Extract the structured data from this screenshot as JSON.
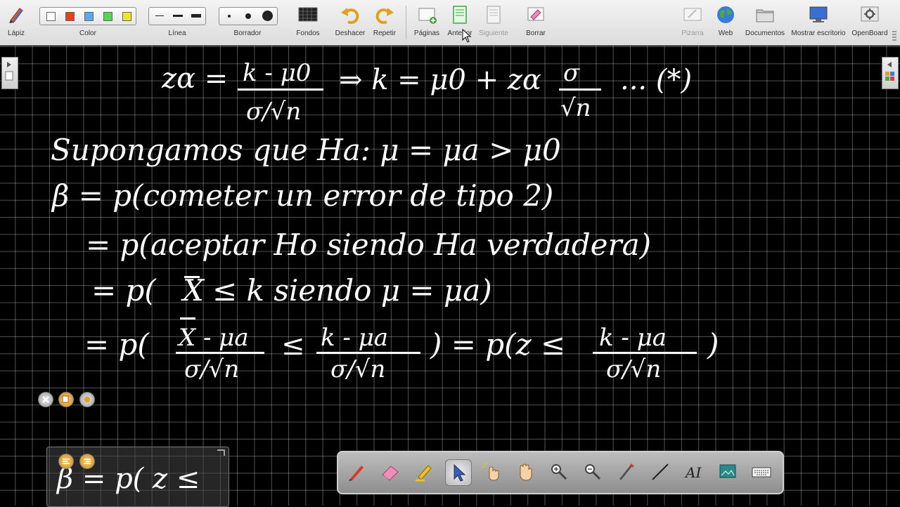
{
  "toolbar": {
    "pencil_label": "Lápiz",
    "color_label": "Color",
    "line_label": "Línea",
    "eraser_label": "Borrador",
    "backgrounds_label": "Fondos",
    "undo_label": "Deshacer",
    "redo_label": "Repetir",
    "pages_label": "Páginas",
    "previous_label": "Anterior",
    "next_label": "Siguiente",
    "clear_label": "Borrar",
    "board_label": "Pizarra",
    "web_label": "Web",
    "documents_label": "Documentos",
    "show_desktop_label": "Mostrar escritorio",
    "openboard_label": "OpenBoard"
  },
  "colors": {
    "palette": [
      "#ffffff",
      "#e8401c",
      "#5aaaf0",
      "#5ad25a",
      "#f0e628"
    ],
    "ink": "#ffffff",
    "board": "#000000"
  },
  "board_lines": {
    "line1_lhs": "zα =",
    "line1_num": "k - μ0",
    "line1_den": "σ/√n",
    "line1_implies": "⇒ k = μ0 + zα",
    "line1_frac_num": "σ",
    "line1_frac_den": "√n",
    "line1_tail": "... (*)",
    "line2": "Supongamos que Ha: μ = μa > μ0",
    "line3": "β = p(cometer un error de tipo 2)",
    "line4": "= p(aceptar Ho siendo Ha verdadera)",
    "line5_pre": "= p(",
    "line5_xbar": "X",
    "line5_post": "≤ k siendo μ = μa)",
    "line6_eq": "= p(",
    "line6_num1": "X - μa",
    "line6_den1": "σ/√n",
    "line6_le": "≤",
    "line6_num2": "k - μa",
    "line6_den2": "σ/√n",
    "line6_mid": ") = p(z ≤",
    "line6_num3": "k - μa",
    "line6_den3": "σ/√n",
    "line6_close": ")",
    "widget_text": "β = p( z ≤"
  },
  "dock": {
    "tools": [
      "pen-tool",
      "eraser-tool",
      "marker-tool",
      "selector-tool",
      "interact-tool",
      "hand-tool",
      "zoom-in-tool",
      "zoom-out-tool",
      "laser-pointer-tool",
      "line-tool",
      "text-tool",
      "capture-tool",
      "keyboard-tool"
    ],
    "active_tool": "selector-tool"
  }
}
